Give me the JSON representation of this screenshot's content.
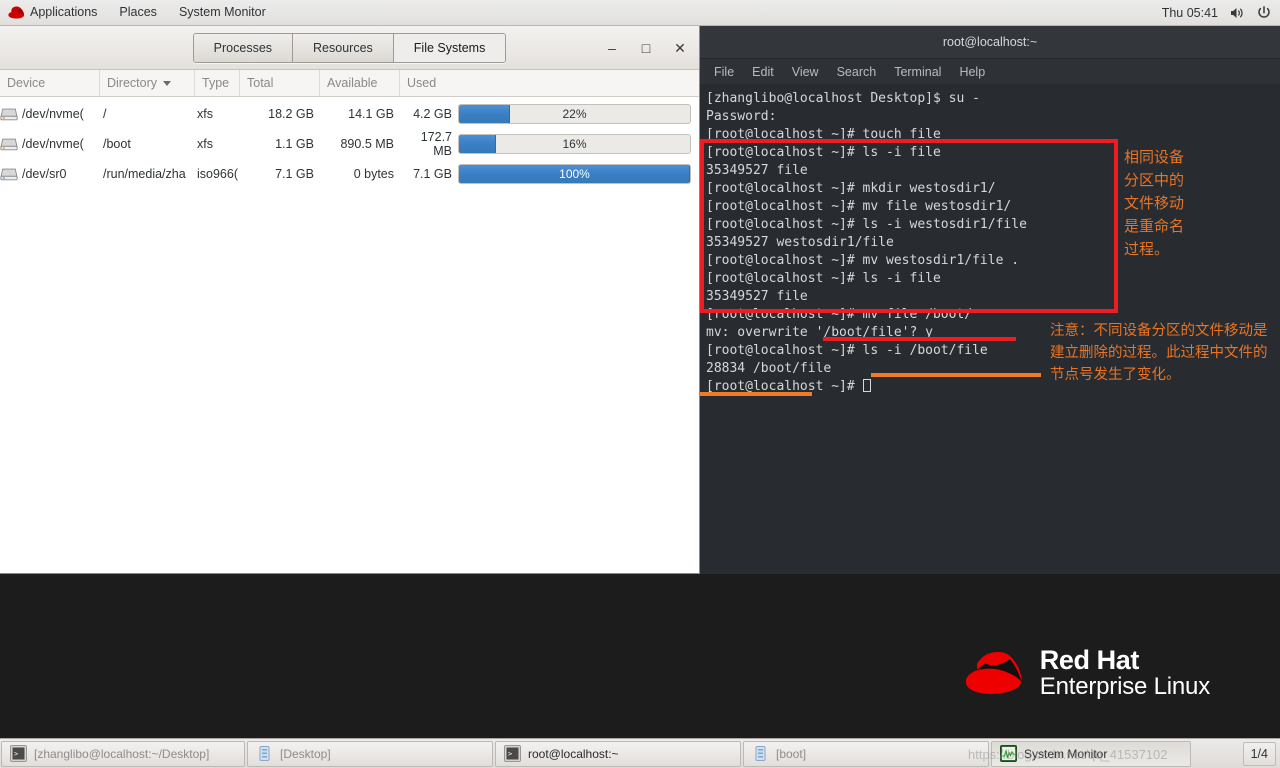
{
  "topbar": {
    "logo_icon": "redhat-hat-icon",
    "applications": "Applications",
    "places": "Places",
    "app_name": "System Monitor",
    "clock": "Thu 05:41",
    "volume_icon": "volume-icon",
    "power_icon": "power-icon"
  },
  "system_monitor": {
    "tabs": [
      {
        "label": "Processes",
        "active": false
      },
      {
        "label": "Resources",
        "active": false
      },
      {
        "label": "File Systems",
        "active": true
      }
    ],
    "window_buttons": {
      "minimize": "–",
      "maximize": "□",
      "close": "✕"
    },
    "columns": [
      "Device",
      "Directory",
      "Type",
      "Total",
      "Available",
      "Used"
    ],
    "sorted_column": "Directory",
    "rows": [
      {
        "device": "/dev/nvme(",
        "directory": "/",
        "type": "xfs",
        "total": "18.2 GB",
        "available": "14.1 GB",
        "used": "4.2 GB",
        "percent_label": "22%",
        "percent": 22
      },
      {
        "device": "/dev/nvme(",
        "directory": "/boot",
        "type": "xfs",
        "total": "1.1 GB",
        "available": "890.5 MB",
        "used": "172.7 MB",
        "percent_label": "16%",
        "percent": 16
      },
      {
        "device": "/dev/sr0",
        "directory": "/run/media/zha",
        "type": "iso966(",
        "total": "7.1 GB",
        "available": "0 bytes",
        "used": "7.1 GB",
        "percent_label": "100%",
        "percent": 100
      }
    ]
  },
  "terminal": {
    "title": "root@localhost:~",
    "menu": [
      "File",
      "Edit",
      "View",
      "Search",
      "Terminal",
      "Help"
    ],
    "lines": [
      "[zhanglibo@localhost Desktop]$ su -",
      "Password:",
      "[root@localhost ~]# touch file",
      "[root@localhost ~]# ls -i file",
      "35349527 file",
      "[root@localhost ~]# mkdir westosdir1/",
      "[root@localhost ~]# mv file westosdir1/",
      "[root@localhost ~]# ls -i westosdir1/file",
      "35349527 westosdir1/file",
      "[root@localhost ~]# mv westosdir1/file .",
      "[root@localhost ~]# ls -i file",
      "35349527 file",
      "[root@localhost ~]# mv file /boot/",
      "mv: overwrite '/boot/file'? y",
      "[root@localhost ~]# ls -i /boot/file",
      "28834 /boot/file"
    ],
    "prompt": "[root@localhost ~]# "
  },
  "annotations": {
    "box_color": "#ee1c23",
    "text_color": "#e87424",
    "note_1": "相同设备\n分区中的\n文件移动\n是重命名\n过程。",
    "note_2": "注意：不同设备分区的文件移动是建立删除的过程。此过程中文件的节点号发生了变化。"
  },
  "desktop": {
    "brand_line1": "Red Hat",
    "brand_line2": "Enterprise Linux",
    "brand_color": "#ee0000"
  },
  "taskbar": {
    "items": [
      {
        "label": "[zhanglibo@localhost:~/Desktop]",
        "icon": "terminal-icon",
        "state": "normal"
      },
      {
        "label": "[Desktop]",
        "icon": "folder-icon",
        "state": "normal"
      },
      {
        "label": "root@localhost:~",
        "icon": "terminal-icon",
        "state": "active"
      },
      {
        "label": "[boot]",
        "icon": "folder-icon",
        "state": "normal"
      },
      {
        "label": "System Monitor",
        "icon": "system-monitor-icon",
        "state": "pressed"
      }
    ],
    "workspace": "1/4",
    "watermark": "https://blog.csdn.net/qq_41537102"
  }
}
